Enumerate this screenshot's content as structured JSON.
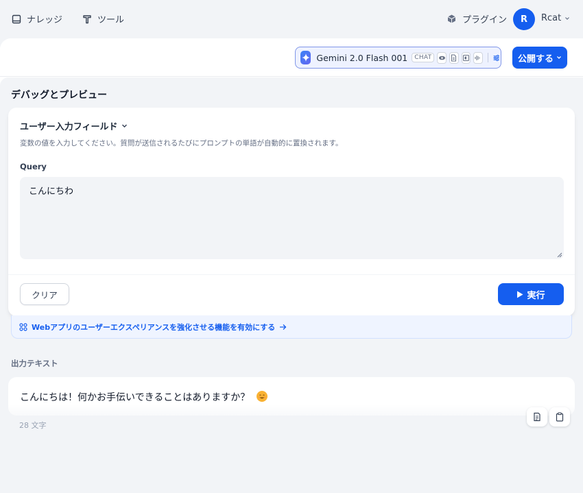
{
  "nav": {
    "knowledge_label": "ナレッジ",
    "tools_label": "ツール",
    "plugins_label": "プラグイン"
  },
  "user": {
    "initial": "R",
    "name": "Rcat"
  },
  "model": {
    "name": "Gemini 2.0 Flash 001",
    "mode_badge": "CHAT",
    "features": [
      "vision-icon",
      "document-icon",
      "video-icon",
      "audio-icon"
    ]
  },
  "toolbar": {
    "publish_label": "公開する"
  },
  "debug": {
    "title": "デバッグとプレビュー",
    "inputs_title": "ユーザー入力フィールド",
    "inputs_desc": "変数の値を入力してください。質問が送信されるたびにプロンプトの単語が自動的に置換されます。",
    "query_label": "Query",
    "query_value": "こんにちわ",
    "clear_label": "クリア",
    "run_label": "実行"
  },
  "webapp_banner": {
    "text": "Webアプリのユーザーエクスペリアンスを強化させる機能を有効にする"
  },
  "output": {
    "label": "出力テキスト",
    "text": "こんにちは！何かお手伝いできることはありますか？",
    "char_count": "28 文字"
  },
  "colors": {
    "primary": "#155eef",
    "page_bg": "#f2f4f7",
    "model_border": "#8096e8"
  }
}
